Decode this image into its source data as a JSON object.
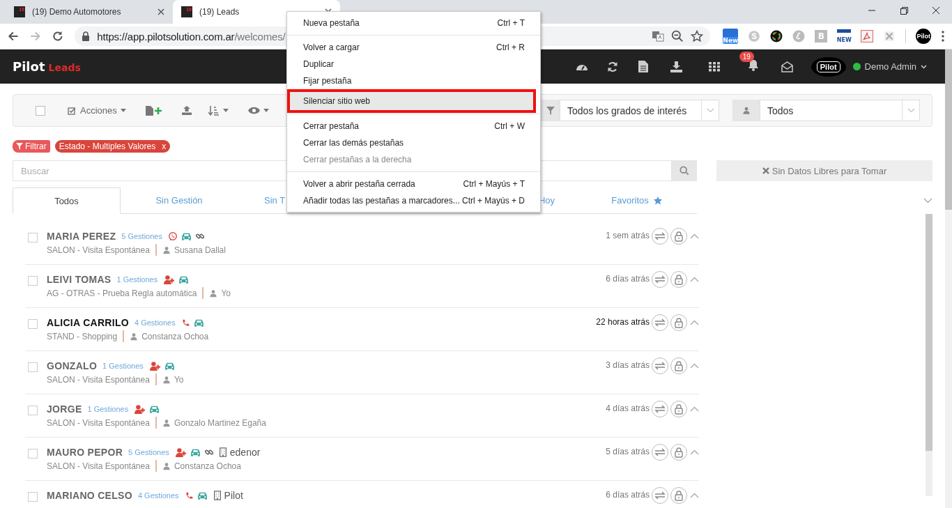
{
  "browser": {
    "tabs": [
      {
        "title": "(19) Demo Automotores",
        "badge": "19",
        "selected": false
      },
      {
        "title": "(19) Leads",
        "badge": "19",
        "selected": true
      }
    ],
    "url_host": "https://app.pilotsolution.com.ar",
    "url_path": "/welcomes/",
    "extensions": [
      {
        "kind": "new",
        "label": "New"
      },
      {
        "kind": "skype"
      },
      {
        "kind": "wheel"
      },
      {
        "kind": "script"
      },
      {
        "kind": "letter",
        "label": "B"
      },
      {
        "kind": "newbox",
        "label": "NEW"
      },
      {
        "kind": "pdf"
      },
      {
        "kind": "greyx"
      }
    ],
    "profile": "Pilot"
  },
  "app": {
    "logo": "Pilot",
    "module": "Leads",
    "notifications": "19",
    "brand": "Pilot",
    "user": "Demo Admin",
    "online": true
  },
  "toolbar": {
    "checked": false,
    "actions": "Acciones",
    "interest": "Todos los grados de interés",
    "owner": "Todos"
  },
  "filters": {
    "button": "Filtrar",
    "chips": [
      {
        "label": "Estado - Multiples Valores",
        "close": "x"
      }
    ]
  },
  "search": {
    "placeholder": "Buscar"
  },
  "free_data": "Sin Datos Libres para Tomar",
  "tabs": [
    {
      "label": "Todos",
      "selected": true
    },
    {
      "label": "Sin Gestión",
      "selected": false
    },
    {
      "label": "Sin T",
      "selected": false
    },
    {
      "label": "Hoy",
      "selected": false
    },
    {
      "label": "Favoritos",
      "star": true,
      "selected": false
    }
  ],
  "leads": [
    {
      "name": "MARIA PEREZ",
      "gestiones": "5 Gestiones",
      "icons": [
        {
          "kind": "whatsapp"
        },
        {
          "kind": "car"
        },
        {
          "kind": "link"
        }
      ],
      "origin": "SALON - Visita Espontánea",
      "user": "Susana Dallal",
      "time": "1 sem atrás",
      "unread": false,
      "checked": false
    },
    {
      "name": "LEIVI TOMAS",
      "gestiones": "1 Gestiones",
      "icons": [
        {
          "kind": "person-add"
        },
        {
          "kind": "car"
        }
      ],
      "origin": "AG - OTRAS - Prueba Regla automática",
      "user": "Yo",
      "time": "6 días atrás",
      "unread": false,
      "checked": false
    },
    {
      "name": "ALICIA CARRILO",
      "gestiones": "4 Gestiones",
      "icons": [
        {
          "kind": "phone"
        },
        {
          "kind": "car"
        }
      ],
      "origin": "STAND - Shopping",
      "user": "Constanza Ochoa",
      "time": "22 horas atrás",
      "unread": true,
      "checked": false
    },
    {
      "name": "GONZALO",
      "gestiones": "1 Gestiones",
      "icons": [
        {
          "kind": "person-add"
        },
        {
          "kind": "car"
        }
      ],
      "origin": "SALON - Visita Espontánea",
      "user": "Yo",
      "time": "3 días atrás",
      "unread": false,
      "checked": false
    },
    {
      "name": "JORGE",
      "gestiones": "1 Gestiones",
      "icons": [
        {
          "kind": "person-add"
        },
        {
          "kind": "car"
        }
      ],
      "origin": "SALON - Visita Espontánea",
      "user": "Gonzalo Martinez Egaña",
      "time": "4 días atrás",
      "unread": false,
      "checked": false
    },
    {
      "name": "MAURO PEPOR",
      "gestiones": "5 Gestiones",
      "icons": [
        {
          "kind": "person-add"
        },
        {
          "kind": "car"
        },
        {
          "kind": "link"
        }
      ],
      "company": "edenor",
      "origin": "SALON - Visita Espontánea",
      "user": "Constanza Ochoa",
      "time": "5 días atrás",
      "unread": false,
      "checked": false
    },
    {
      "name": "MARIANO CELSO",
      "gestiones": "4 Gestiones",
      "icons": [
        {
          "kind": "phone"
        },
        {
          "kind": "car"
        }
      ],
      "company": "Pilot",
      "time": "6 días atrás",
      "unread": false,
      "checked": false
    }
  ],
  "menu": [
    {
      "kind": "item",
      "label": "Nueva pestaña",
      "shortcut": "Ctrl + T",
      "selected": false,
      "disabled": false,
      "marked": false
    },
    {
      "kind": "separator"
    },
    {
      "kind": "item",
      "label": "Volver a cargar",
      "shortcut": "Ctrl + R",
      "selected": false,
      "disabled": false,
      "marked": false
    },
    {
      "kind": "item",
      "label": "Duplicar",
      "selected": false,
      "disabled": false,
      "marked": false
    },
    {
      "kind": "item",
      "label": "Fijar pestaña",
      "selected": false,
      "disabled": false,
      "marked": false
    },
    {
      "kind": "item",
      "label": "Silenciar sitio web",
      "selected": true,
      "disabled": false,
      "marked": true
    },
    {
      "kind": "separator"
    },
    {
      "kind": "item",
      "label": "Cerrar pestaña",
      "shortcut": "Ctrl + W",
      "selected": false,
      "disabled": false,
      "marked": false
    },
    {
      "kind": "item",
      "label": "Cerrar las demás pestañas",
      "selected": false,
      "disabled": false,
      "marked": false
    },
    {
      "kind": "item",
      "label": "Cerrar pestañas a la derecha",
      "selected": false,
      "disabled": true,
      "marked": false
    },
    {
      "kind": "separator"
    },
    {
      "kind": "item",
      "label": "Volver a abrir pestaña cerrada",
      "shortcut": "Ctrl + Mayús + T",
      "selected": false,
      "disabled": false,
      "marked": false
    },
    {
      "kind": "item",
      "label": "Añadir todas las pestañas a marcadores...",
      "shortcut": "Ctrl + Mayús + D",
      "selected": false,
      "disabled": false,
      "marked": false
    }
  ]
}
